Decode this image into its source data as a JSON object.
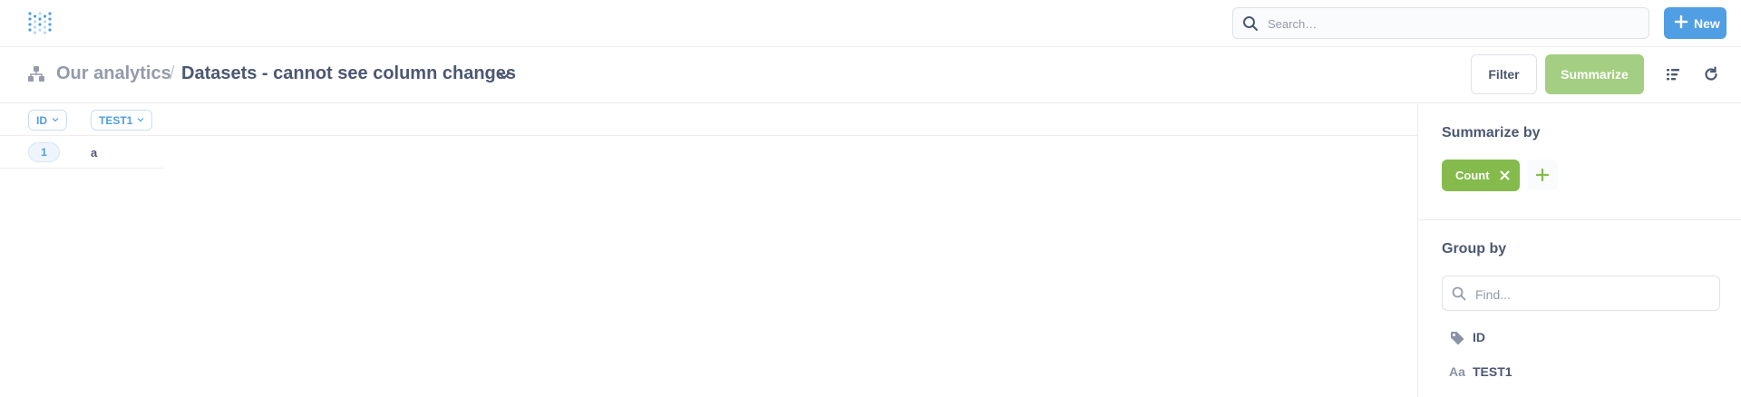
{
  "nav": {
    "search_placeholder": "Search…",
    "new_label": "New"
  },
  "header": {
    "collection": "Our analytics",
    "separator": "/",
    "title": "Datasets - cannot see column changes",
    "filter_label": "Filter",
    "summarize_label": "Summarize"
  },
  "table": {
    "columns": [
      "ID",
      "TEST1"
    ],
    "rows": [
      [
        "1",
        "a"
      ]
    ]
  },
  "sidebar": {
    "summarize_title": "Summarize by",
    "metric": "Count",
    "group_title": "Group by",
    "find_placeholder": "Find...",
    "fields": [
      {
        "icon": "tag-icon",
        "label": "ID"
      },
      {
        "icon": "text-type-icon",
        "glyph": "Aa",
        "label": "TEST1"
      }
    ]
  },
  "colors": {
    "brand": "#509ee3",
    "summarize": "#84bb4c",
    "summarize_light": "#a4ce81",
    "text": "#4c5773",
    "muted": "#949aab"
  }
}
